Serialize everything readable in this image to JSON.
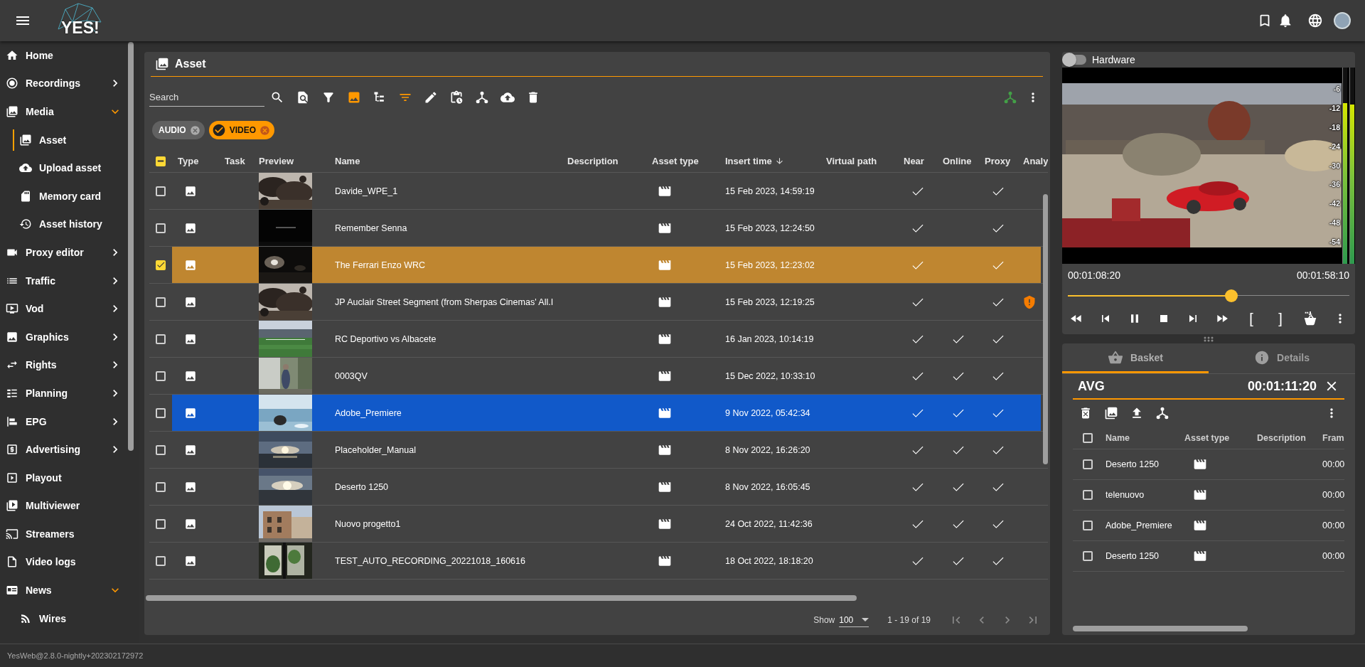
{
  "topbar": {
    "logo": "YES!"
  },
  "sidebar": {
    "items": [
      {
        "label": "Home",
        "selected": false
      },
      {
        "label": "Recordings",
        "selected": false,
        "expanded": false
      },
      {
        "label": "Media",
        "selected": false,
        "expanded": true,
        "children": [
          {
            "label": "Asset",
            "selected": true
          },
          {
            "label": "Upload asset",
            "selected": false
          },
          {
            "label": "Memory card",
            "selected": false
          },
          {
            "label": "Asset history",
            "selected": false
          }
        ]
      },
      {
        "label": "Proxy editor",
        "selected": false,
        "expanded": false
      },
      {
        "label": "Traffic",
        "selected": false,
        "expanded": false
      },
      {
        "label": "Vod",
        "selected": false,
        "expanded": false
      },
      {
        "label": "Graphics",
        "selected": false,
        "expanded": false
      },
      {
        "label": "Rights",
        "selected": false,
        "expanded": false
      },
      {
        "label": "Planning",
        "selected": false,
        "expanded": false
      },
      {
        "label": "EPG",
        "selected": false,
        "expanded": false
      },
      {
        "label": "Advertising",
        "selected": false,
        "expanded": false
      },
      {
        "label": "Playout",
        "selected": false
      },
      {
        "label": "Multiviewer",
        "selected": false
      },
      {
        "label": "Streamers",
        "selected": false
      },
      {
        "label": "Video logs",
        "selected": false
      },
      {
        "label": "News",
        "selected": false,
        "expanded": true,
        "children": [
          {
            "label": "Wires",
            "selected": false
          }
        ]
      }
    ]
  },
  "asset_panel": {
    "title": "Asset",
    "search": {
      "placeholder": "Search"
    },
    "tools": [
      {
        "active": false
      },
      {
        "active": false
      },
      {
        "active": false
      },
      {
        "active": true
      },
      {
        "active": false
      },
      {
        "active": true
      },
      {
        "active": false
      },
      {
        "active": false
      },
      {
        "active": false
      },
      {
        "active": false
      },
      {
        "active": false
      }
    ],
    "filters": [
      {
        "label": "AUDIO",
        "selected": false
      },
      {
        "label": "VIDEO",
        "selected": true
      }
    ],
    "table": {
      "some_checked": true,
      "columns": [
        {
          "label": "Type",
          "sorted": false
        },
        {
          "label": "Task",
          "sorted": false
        },
        {
          "label": "Preview",
          "sorted": false
        },
        {
          "label": "Name",
          "sorted": false
        },
        {
          "label": "Description",
          "sorted": false
        },
        {
          "label": "Asset type",
          "sorted": false
        },
        {
          "label": "Insert time",
          "sorted": true
        },
        {
          "label": "Virtual path",
          "sorted": false
        },
        {
          "label": "Near",
          "sorted": false
        },
        {
          "label": "Online",
          "sorted": false
        },
        {
          "label": "Proxy",
          "sorted": false
        },
        {
          "label": "Analy",
          "sorted": false
        }
      ],
      "rows": [
        {
          "checked": false,
          "selected": false,
          "name": "Davide_WPE_1",
          "insert_time": "15 Feb 2023, 14:59:19",
          "near": true,
          "online": false,
          "proxy": true,
          "warning": false
        },
        {
          "checked": false,
          "selected": false,
          "name": "Remember Senna",
          "insert_time": "15 Feb 2023, 12:24:50",
          "near": true,
          "online": false,
          "proxy": true,
          "warning": false
        },
        {
          "checked": true,
          "selected": false,
          "name": "The Ferrari Enzo WRC",
          "insert_time": "15 Feb 2023, 12:23:02",
          "near": true,
          "online": false,
          "proxy": true,
          "warning": false
        },
        {
          "checked": false,
          "selected": false,
          "name": "JP Auclair Street Segment (from Sherpas Cinemas' All.I",
          "insert_time": "15 Feb 2023, 12:19:25",
          "near": true,
          "online": false,
          "proxy": true,
          "warning": true
        },
        {
          "checked": false,
          "selected": false,
          "name": "RC Deportivo vs Albacete",
          "insert_time": "16 Jan 2023, 10:14:19",
          "near": true,
          "online": true,
          "proxy": true,
          "warning": false
        },
        {
          "checked": false,
          "selected": false,
          "name": "0003QV",
          "insert_time": "15 Dec 2022, 10:33:10",
          "near": true,
          "online": true,
          "proxy": true,
          "warning": false
        },
        {
          "checked": false,
          "selected": true,
          "name": "Adobe_Premiere",
          "insert_time": "9 Nov 2022, 05:42:34",
          "near": true,
          "online": true,
          "proxy": true,
          "warning": false
        },
        {
          "checked": false,
          "selected": false,
          "name": "Placeholder_Manual",
          "insert_time": "8 Nov 2022, 16:26:20",
          "near": true,
          "online": true,
          "proxy": true,
          "warning": false
        },
        {
          "checked": false,
          "selected": false,
          "name": "Deserto 1250",
          "insert_time": "8 Nov 2022, 16:05:45",
          "near": true,
          "online": true,
          "proxy": true,
          "warning": false
        },
        {
          "checked": false,
          "selected": false,
          "name": "Nuovo progetto1",
          "insert_time": "24 Oct 2022, 11:42:36",
          "near": true,
          "online": true,
          "proxy": true,
          "warning": false
        },
        {
          "checked": false,
          "selected": false,
          "name": "TEST_AUTO_RECORDING_20221018_160616",
          "insert_time": "18 Oct 2022, 18:18:20",
          "near": true,
          "online": true,
          "proxy": true,
          "warning": false
        }
      ]
    },
    "footer": {
      "show_label": "Show",
      "page_size": "100",
      "range": "1 - 19 of 19",
      "nav_disabled": true
    }
  },
  "player": {
    "hardware": {
      "label": "Hardware",
      "on": false
    },
    "meter": {
      "scale": [
        "-6",
        "-12",
        "-18",
        "-24",
        "-30",
        "-36",
        "-42",
        "-48",
        "-54"
      ],
      "channels": [
        {
          "level": 0.82
        },
        {
          "level": 0.81
        }
      ]
    },
    "time_current": "00:01:08:20",
    "time_total": "00:01:58:10",
    "position": {
      "level": 0.58
    },
    "mark_in": "[",
    "mark_out": "]"
  },
  "basket": {
    "tabs": [
      {
        "label": "Basket",
        "selected": true
      },
      {
        "label": "Details",
        "selected": false
      }
    ],
    "name": "AVG",
    "duration": "00:01:11:20",
    "all_checked": false,
    "columns": [
      "Name",
      "Asset type",
      "Description",
      "Fram"
    ],
    "rows": [
      {
        "checked": false,
        "name": "Deserto 1250",
        "column_4": "00:00"
      },
      {
        "checked": false,
        "name": "telenuovo",
        "column_4": "00:00"
      },
      {
        "checked": false,
        "name": "Adobe_Premiere",
        "column_4": "00:00"
      },
      {
        "checked": false,
        "name": "Deserto 1250",
        "column_4": "00:00"
      }
    ]
  },
  "status_bar": {
    "text": "YesWeb@2.8.0-nightly+202302172972"
  }
}
